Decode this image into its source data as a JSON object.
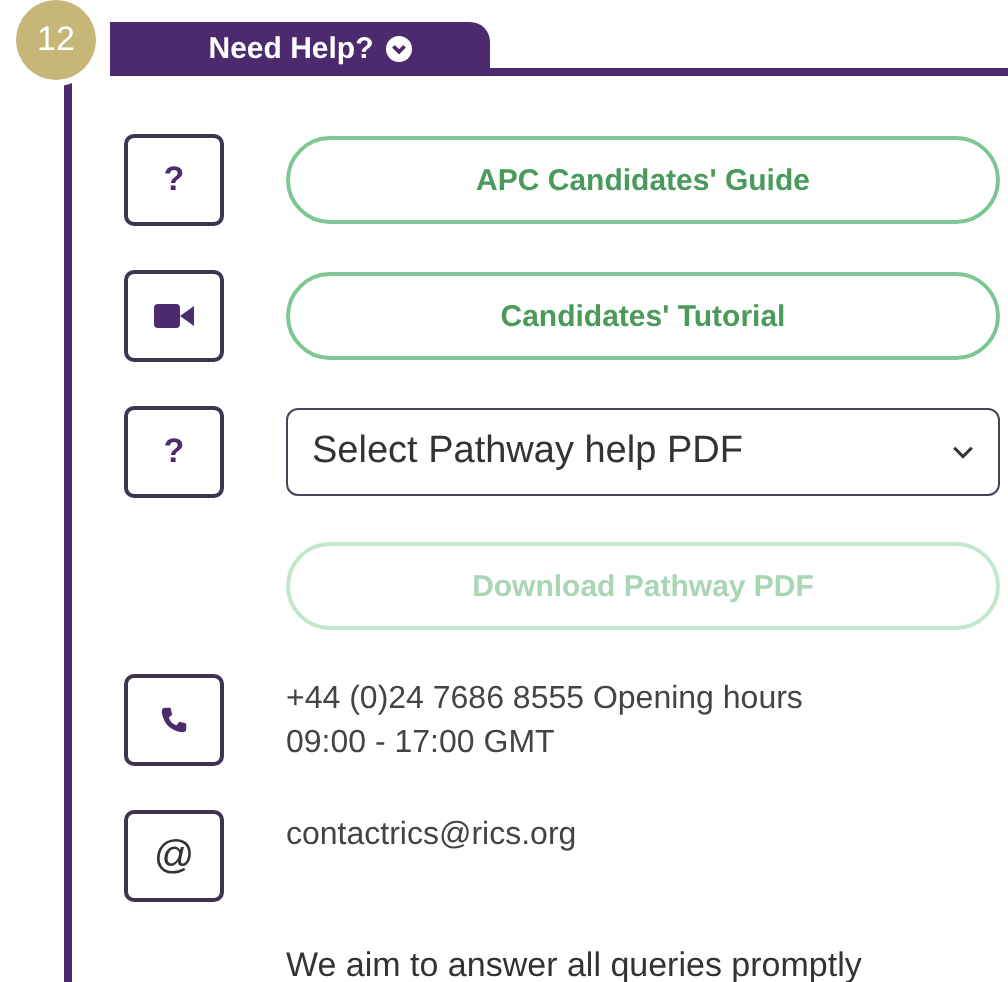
{
  "step_badge": "12",
  "tab": {
    "label": "Need Help?",
    "expanded": true
  },
  "rows": [
    {
      "kind": "help_button",
      "glyph": "?",
      "label": "APC Candidates' Guide",
      "disabled": false
    },
    {
      "kind": "video_button",
      "label": "Candidates' Tutorial",
      "disabled": false
    },
    {
      "kind": "select",
      "glyph": "?",
      "placeholder": "Select Pathway help PDF"
    },
    {
      "kind": "plain_button",
      "label": "Download Pathway PDF",
      "disabled": true
    },
    {
      "kind": "phone",
      "text": "+44 (0)24 7686 8555 Opening hours 09:00 - 17:00 GMT"
    },
    {
      "kind": "email",
      "glyph": "@",
      "text": "contactrics@rics.org"
    }
  ],
  "note": "We aim to answer all queries promptly"
}
